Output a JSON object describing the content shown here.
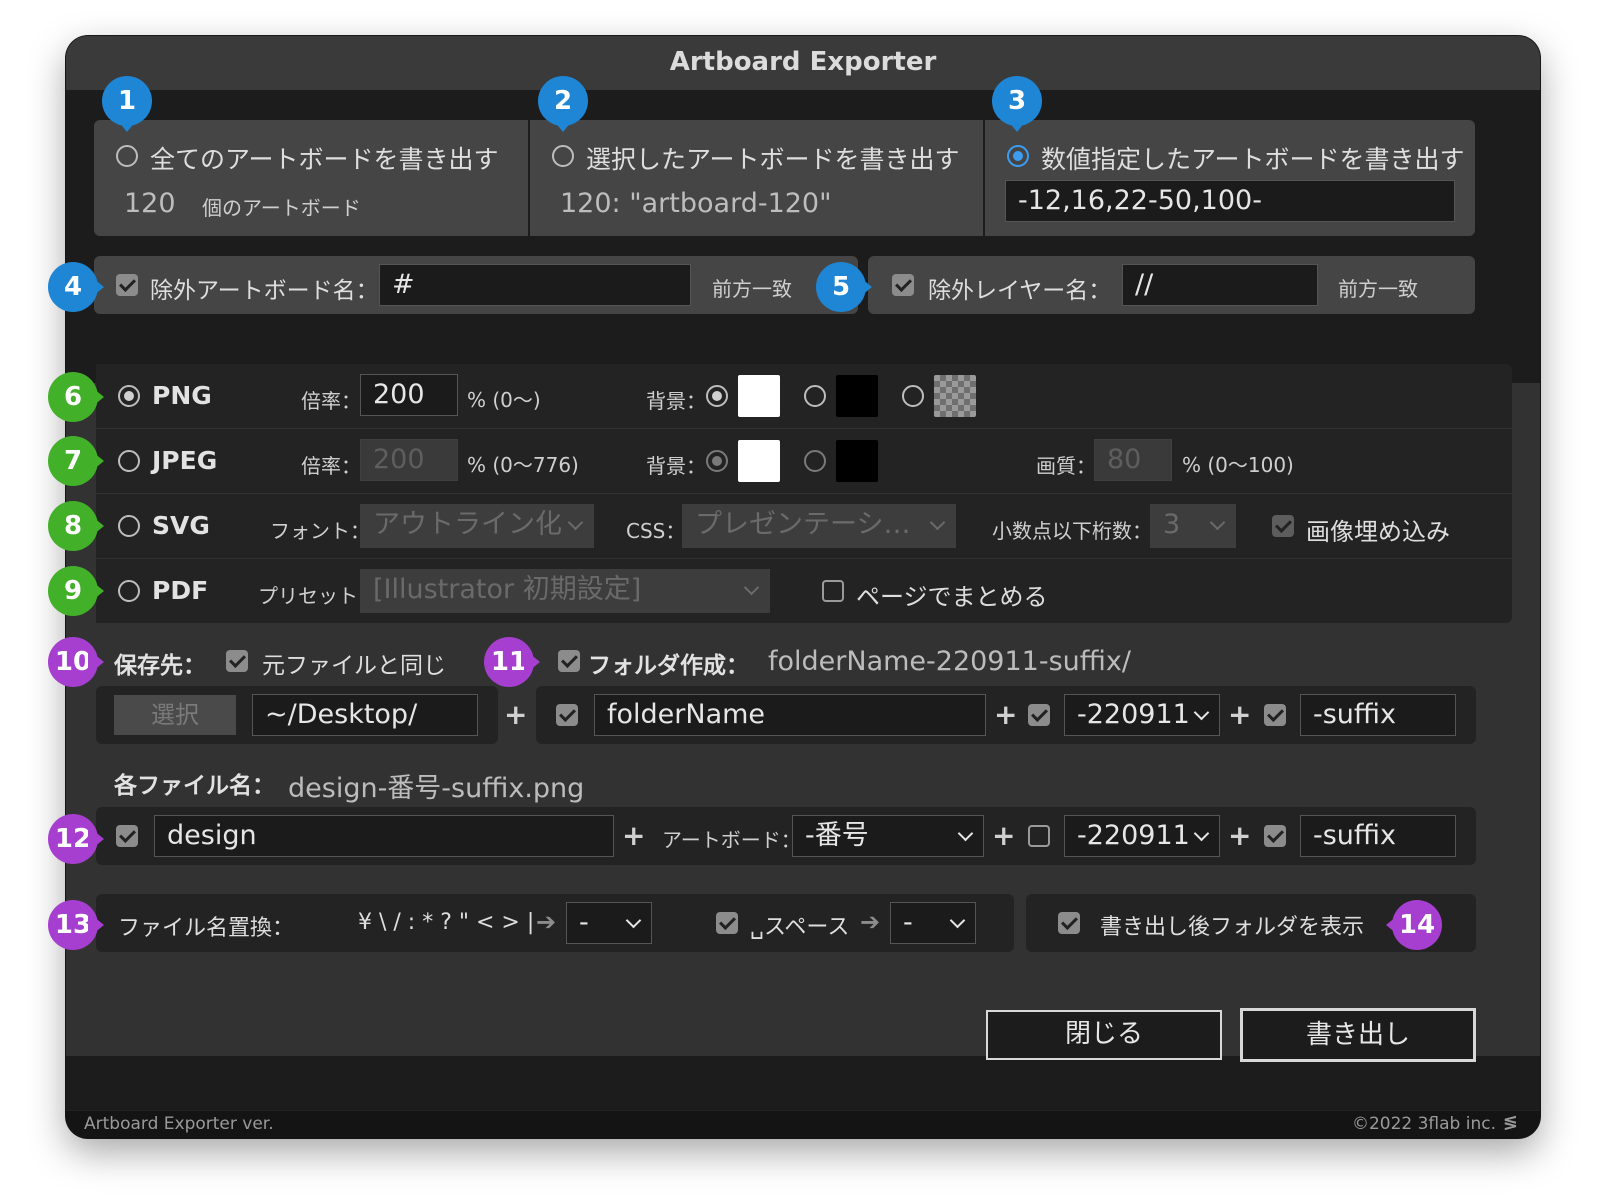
{
  "window": {
    "title": "Artboard Exporter"
  },
  "badges": [
    "1",
    "2",
    "3",
    "4",
    "5",
    "6",
    "7",
    "8",
    "9",
    "10",
    "11",
    "12",
    "13",
    "14"
  ],
  "target": {
    "all": {
      "label": "全てのアートボードを書き出す",
      "count": "120",
      "count_label": "個のアートボード"
    },
    "selected": {
      "label": "選択したアートボードを書き出す",
      "value": "120: \"artboard-120\""
    },
    "specified": {
      "label": "数値指定したアートボードを書き出す",
      "value": "-12,16,22-50,100-"
    }
  },
  "exclude": {
    "artboard_label": "除外アートボード名：",
    "artboard_value": "#",
    "artboard_match": "前方一致",
    "layer_label": "除外レイヤー名：",
    "layer_value": "//",
    "layer_match": "前方一致"
  },
  "formats": {
    "png": {
      "label": "PNG",
      "scale_label": "倍率：",
      "scale": "200",
      "range": "% (0〜)",
      "bg_label": "背景："
    },
    "jpeg": {
      "label": "JPEG",
      "scale_label": "倍率：",
      "scale": "200",
      "range": "% (0〜776)",
      "bg_label": "背景：",
      "quality_label": "画質：",
      "quality": "80",
      "quality_range": "% (0〜100)"
    },
    "svg": {
      "label": "SVG",
      "font_label": "フォント：",
      "font": "アウトライン化",
      "css_label": "CSS：",
      "css": "プレゼンテーシ…",
      "decimal_label": "小数点以下桁数：",
      "decimal": "3",
      "embed_label": "画像埋め込み"
    },
    "pdf": {
      "label": "PDF",
      "preset_label": "プリセット：",
      "preset": "[Illustrator 初期設定]",
      "combine_label": "ページでまとめる"
    }
  },
  "save": {
    "label": "保存先：",
    "same_label": "元ファイルと同じ",
    "select_button": "選択",
    "path": "~/Desktop/",
    "folder_label": "フォルダ作成：",
    "folder_preview": "folderName-220911-suffix/",
    "folder_name": "folderName",
    "folder_date": "-220911",
    "folder_suffix": "-suffix"
  },
  "filename": {
    "label": "各ファイル名：",
    "preview": "design-番号-suffix.png",
    "prefix": "design",
    "artboard_label": "アートボード：",
    "artboard_option": "-番号",
    "date": "-220911",
    "suffix": "-suffix"
  },
  "replace": {
    "label": "ファイル名置換：",
    "chars": "¥ \\ / : * ? \" < > |",
    "chars_to": "-",
    "space_label": "␣スペース",
    "space_to": "-",
    "show_folder_label": "書き出し後フォルダを表示"
  },
  "buttons": {
    "close": "閉じる",
    "export": "書き出し"
  },
  "footer": {
    "version": "Artboard Exporter ver.",
    "copyright": "©2022 3flab inc."
  },
  "colors": {
    "blue": "#1e86d4",
    "green": "#43b02a",
    "purple": "#a63fcf",
    "accent": "#3d9cf0"
  }
}
